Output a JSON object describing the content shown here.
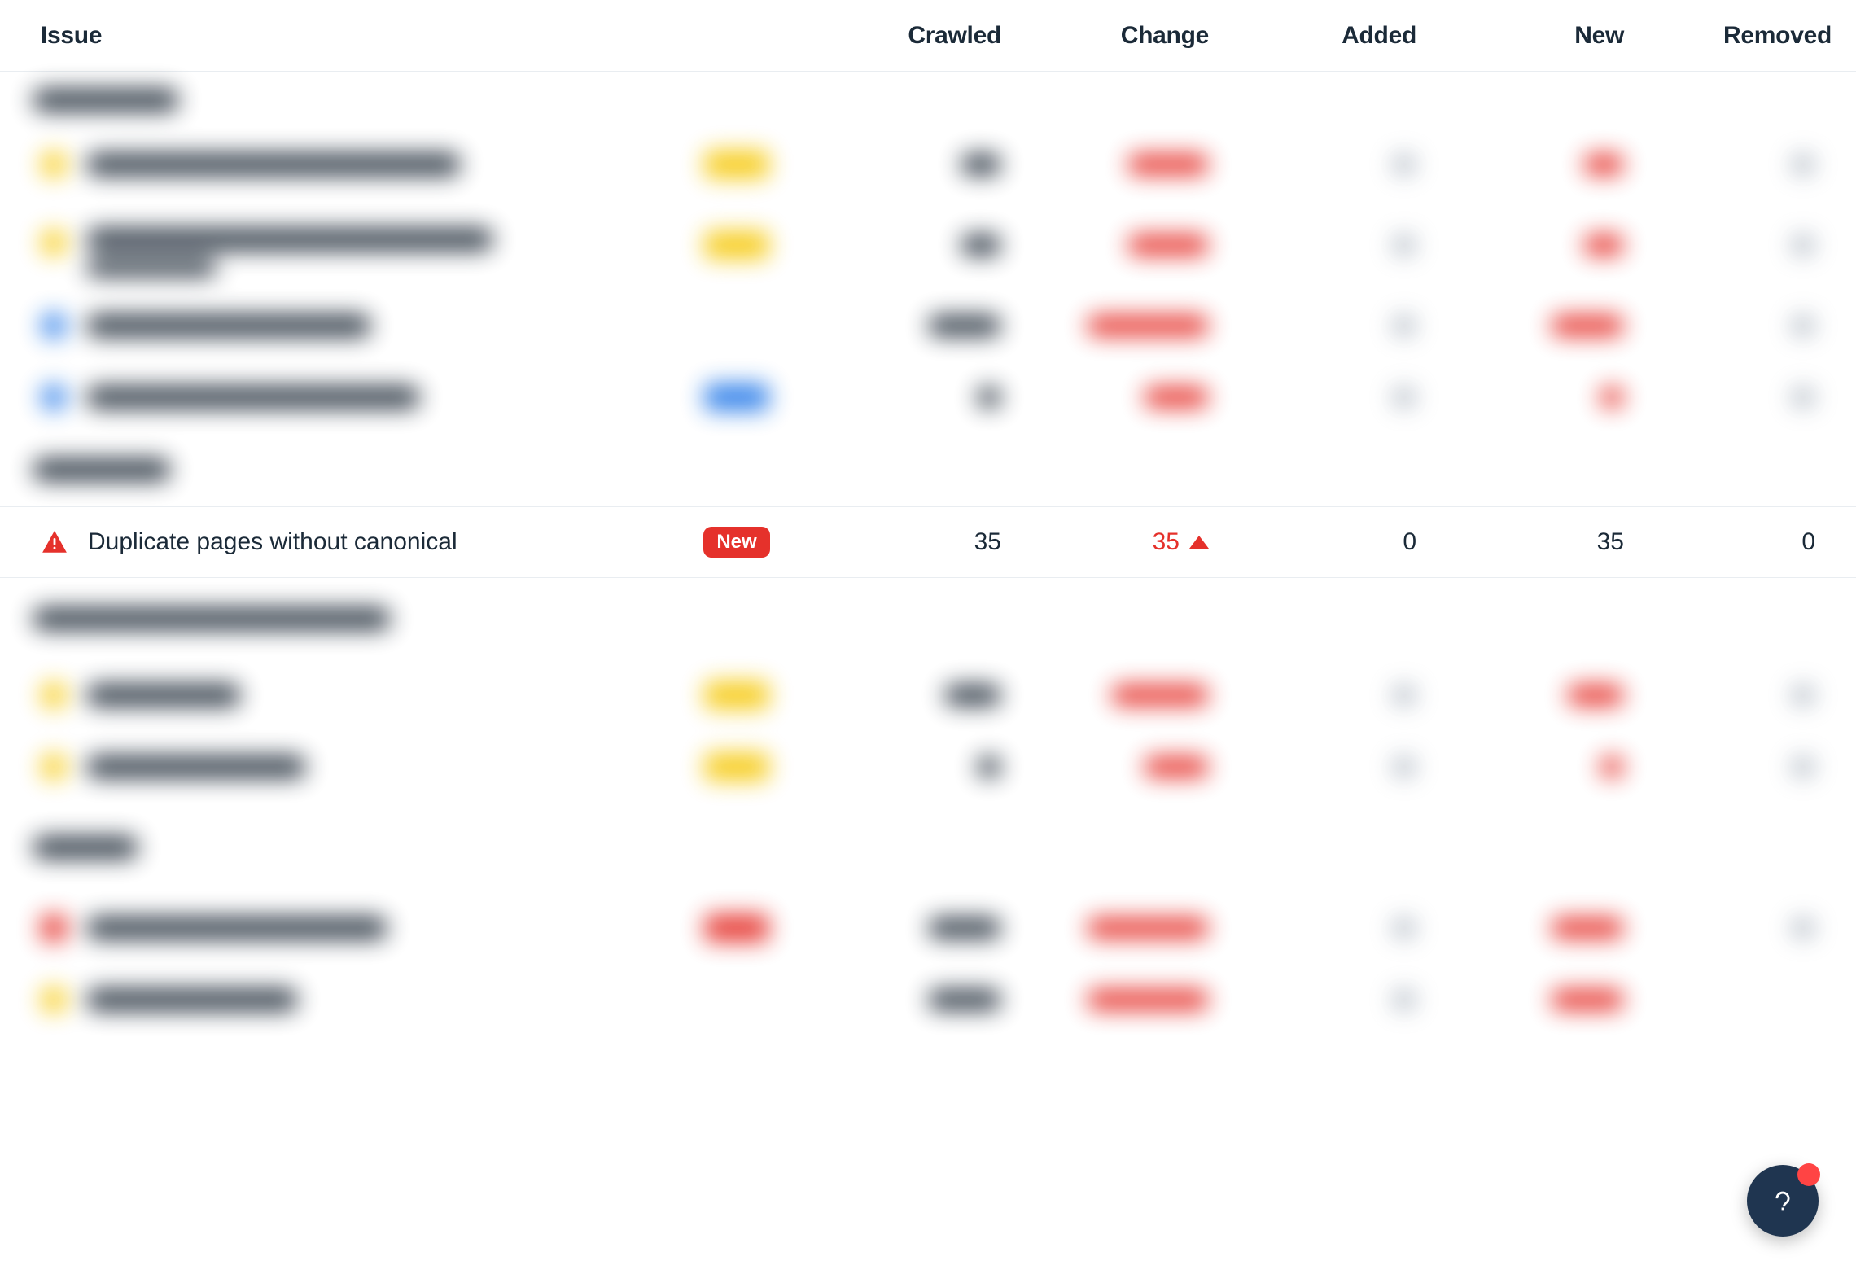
{
  "columns": {
    "issue": "Issue",
    "crawled": "Crawled",
    "change": "Change",
    "added": "Added",
    "new": "New",
    "removed": "Removed"
  },
  "focused_row": {
    "label": "Duplicate pages without canonical",
    "tag": "New",
    "crawled": "35",
    "change": "35",
    "change_direction": "up",
    "added": "0",
    "new": "35",
    "removed": "0"
  },
  "colors": {
    "accent_red": "#e5312b",
    "accent_yellow": "#f6c90e",
    "accent_blue": "#2b7de9",
    "fab_bg": "#1f3550"
  }
}
